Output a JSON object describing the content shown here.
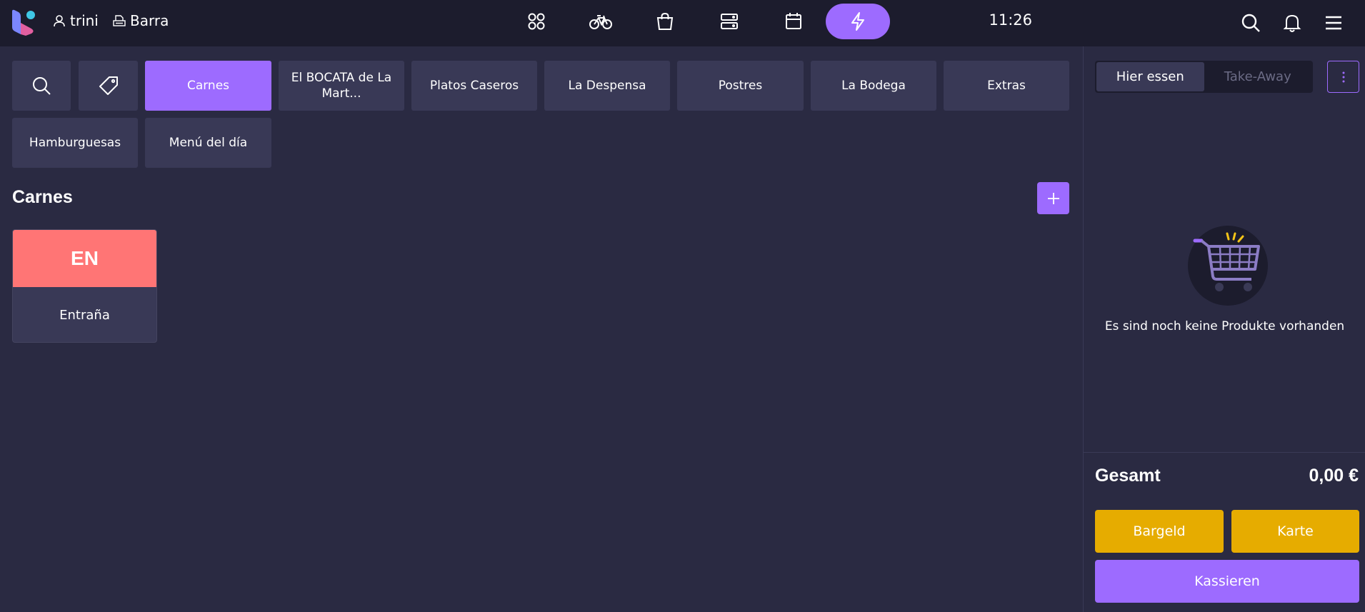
{
  "header": {
    "user": "trini",
    "station": "Barra",
    "clock": "11:26",
    "nav": [
      {
        "icon": "apps-icon"
      },
      {
        "icon": "bike-icon"
      },
      {
        "icon": "shopping-bag-icon"
      },
      {
        "icon": "server-icon"
      },
      {
        "icon": "calendar-icon"
      },
      {
        "icon": "lightning-icon",
        "active": true
      }
    ]
  },
  "categories": {
    "row1": [
      "Carnes",
      "El BOCATA de La Mart...",
      "Platos Caseros",
      "La Despensa",
      "Postres",
      "La Bodega",
      "Extras"
    ],
    "row2": [
      "Hamburguesas",
      "Menú del día"
    ],
    "active": "Carnes"
  },
  "section": {
    "title": "Carnes"
  },
  "products": [
    {
      "abbr": "EN",
      "name": "Entraña",
      "color": "#ff7575"
    }
  ],
  "order": {
    "mode_dine_in": "Hier essen",
    "mode_takeaway": "Take-Away",
    "empty_message": "Es sind noch keine Produkte vorhanden",
    "total_label": "Gesamt",
    "total_value": "0,00 €",
    "cash_label": "Bargeld",
    "card_label": "Karte",
    "checkout_label": "Kassieren"
  },
  "colors": {
    "accent": "#9d6bff",
    "pay": "#e6ac00",
    "background": "#2a2a42",
    "topbar": "#1c1c2d",
    "tile": "#393956"
  }
}
